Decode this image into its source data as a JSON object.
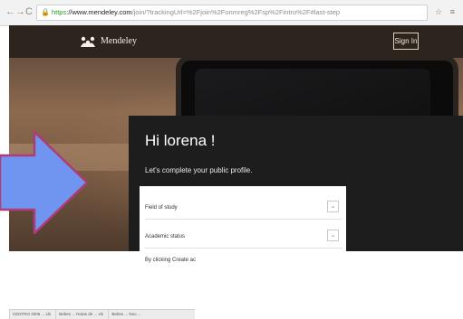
{
  "browser": {
    "back_icon": "arrow-left-icon",
    "forward_icon": "arrow-right-icon",
    "reload_icon": "reload-icon",
    "url_https": "https",
    "url_host": "://www.mendeley.com",
    "url_path": "/join/?trackingUrl=%2Fjoin%2Fonmreg%2Fsp%2Fintro%2F#last-step",
    "tools": "☆ ≡"
  },
  "header": {
    "logo_text": "Mendeley",
    "signin_label": "Sign In"
  },
  "card": {
    "greeting": "Hi lorena !",
    "subtitle": "Let's complete your public profile."
  },
  "form": {
    "field_of_study": "Field of study",
    "academic_status": "Academic status",
    "consent_text": "By clicking Create ac"
  },
  "downloads": {
    "items": [
      "CENTRO 2006 ... xls",
      "Bebes ... Notas de ... xls",
      "Bebes ... Noo ..."
    ]
  },
  "colors": {
    "header_bg": "#2d241d",
    "card_bg": "#1d1d1e",
    "arrow_fill": "#6f95f0",
    "arrow_border": "#b03a7a"
  }
}
